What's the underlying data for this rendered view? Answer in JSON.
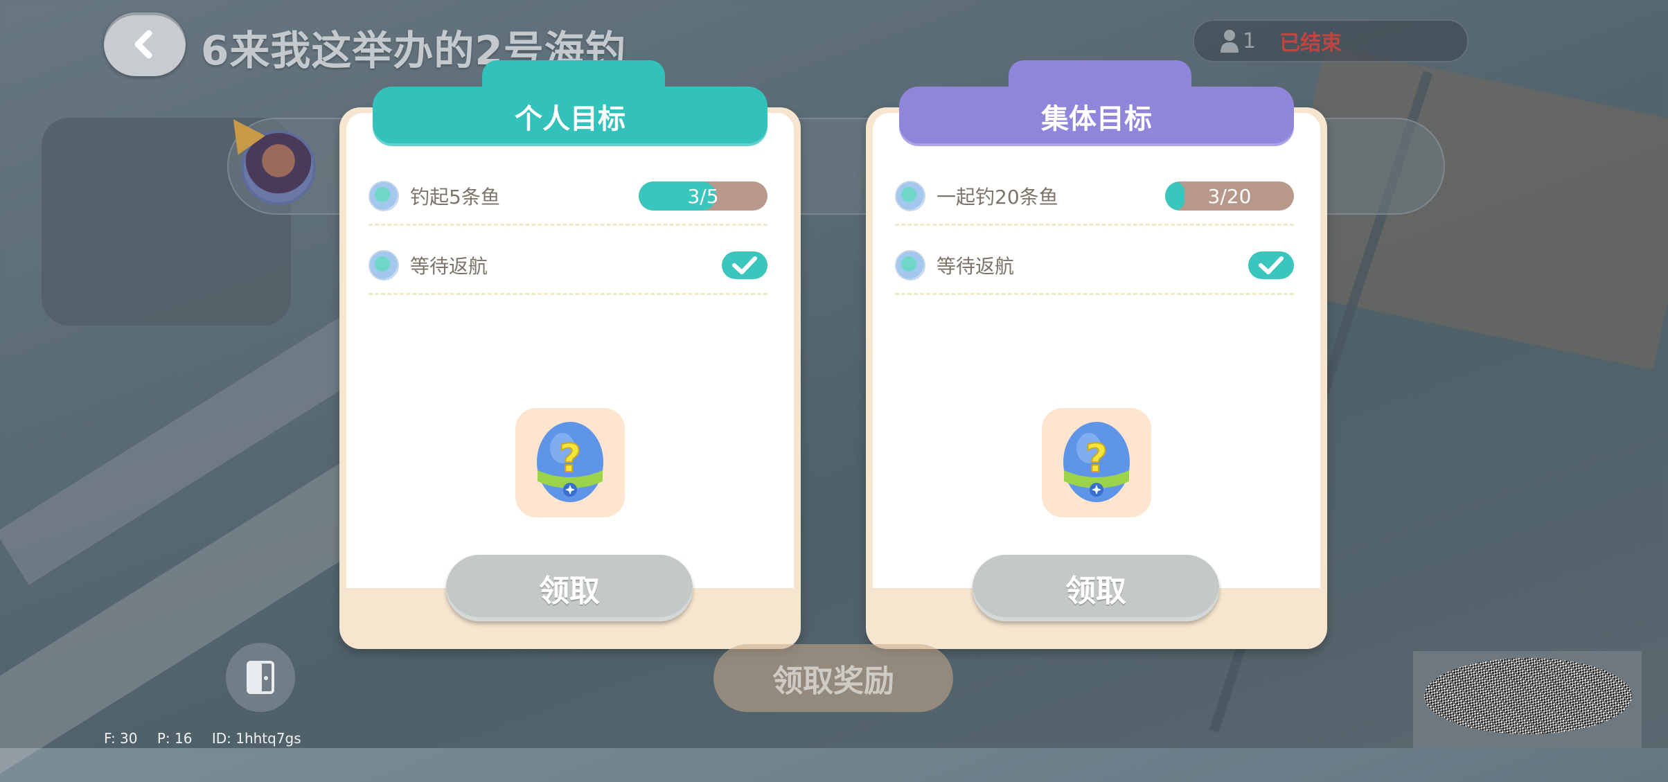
{
  "header": {
    "room_title": "6来我这举办的2号海钓",
    "player_count": "1",
    "status": "已结束"
  },
  "panels": [
    {
      "tab_label": "个人目标",
      "goals": [
        {
          "text": "钓起5条鱼",
          "progress_label": "3/5",
          "progress_value": 3,
          "progress_max": 5
        },
        {
          "text": "等待返航",
          "completed": true
        }
      ],
      "reward_icon": "mystery-egg-icon",
      "claim_label": "领取"
    },
    {
      "tab_label": "集体目标",
      "goals": [
        {
          "text": "一起钓20条鱼",
          "progress_label": "3/20",
          "progress_value": 3,
          "progress_max": 20
        },
        {
          "text": "等待返航",
          "completed": true
        }
      ],
      "reward_icon": "mystery-egg-icon",
      "claim_label": "领取"
    }
  ],
  "footer": {
    "collect_rewards_label": "领取奖励",
    "debug_f": "F: 30",
    "debug_p": "P: 16",
    "debug_id": "ID: 1hhtq7gs"
  },
  "colors": {
    "personal_tab": "#33c2bb",
    "team_tab": "#8f86dc",
    "progress_fill": "#3bc6bd",
    "progress_track": "#b8988a",
    "ended_status": "#c0453f",
    "panel_frame": "#f7e6cf"
  }
}
